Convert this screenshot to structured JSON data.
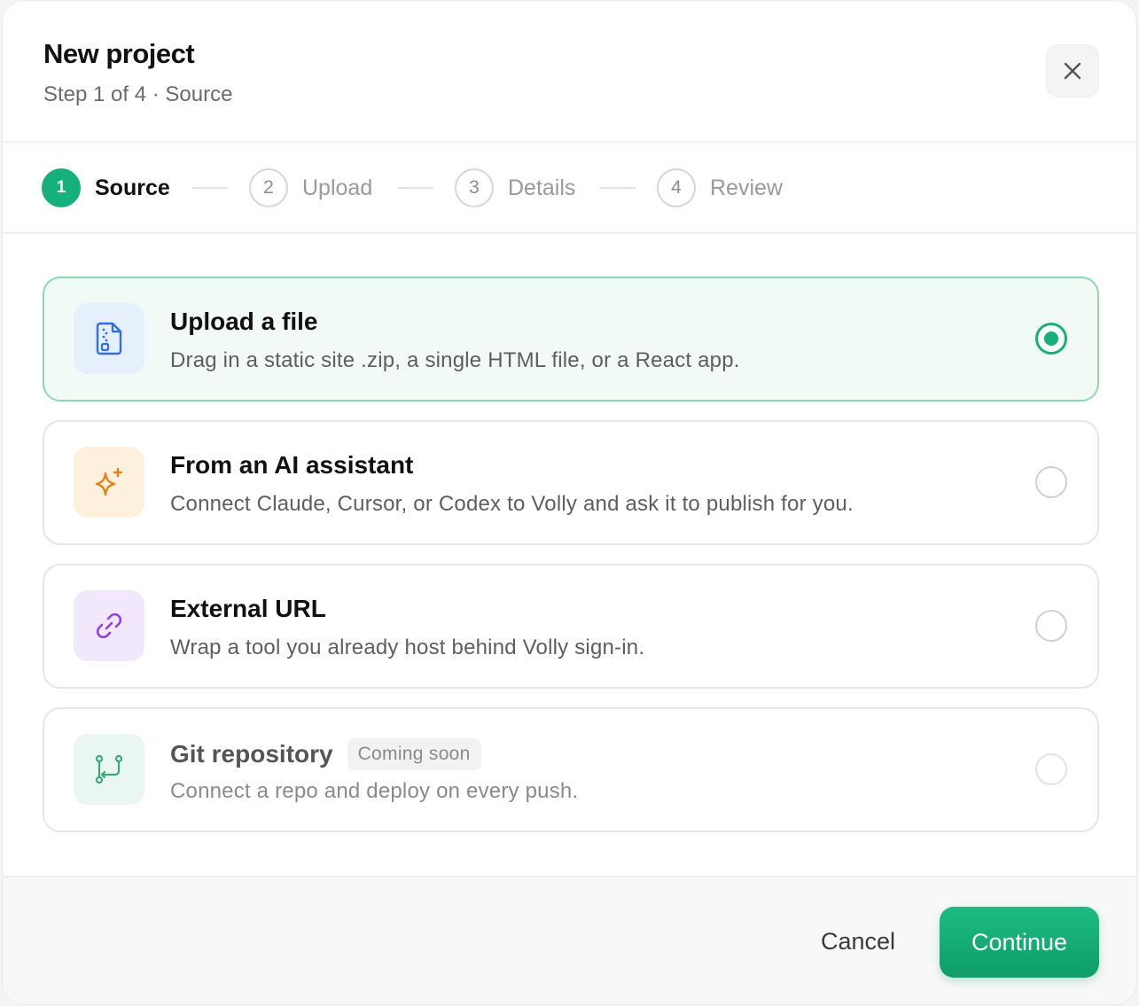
{
  "header": {
    "title": "New project",
    "subtitle": "Step 1 of 4 · Source"
  },
  "stepper": {
    "steps": [
      {
        "number": "1",
        "label": "Source",
        "active": true
      },
      {
        "number": "2",
        "label": "Upload",
        "active": false
      },
      {
        "number": "3",
        "label": "Details",
        "active": false
      },
      {
        "number": "4",
        "label": "Review",
        "active": false
      }
    ]
  },
  "options": [
    {
      "title": "Upload a file",
      "description": "Drag in a static site .zip, a single HTML file, or a React app.",
      "icon": "file-upload-icon",
      "selected": true
    },
    {
      "title": "From an AI assistant",
      "description": "Connect Claude, Cursor, or Codex to Volly and ask it to publish for you.",
      "icon": "sparkle-icon",
      "selected": false
    },
    {
      "title": "External URL",
      "description": "Wrap a tool you already host behind Volly sign-in.",
      "icon": "link-icon",
      "selected": false
    },
    {
      "title": "Git repository",
      "badge": "Coming soon",
      "description": "Connect a repo and deploy on every push.",
      "icon": "git-branch-icon",
      "selected": false,
      "disabled": true
    }
  ],
  "footer": {
    "cancel_label": "Cancel",
    "continue_label": "Continue"
  },
  "colors": {
    "accent": "#16b07a",
    "selected_border": "#8ed6b4",
    "upload_icon_bg": "#e6effc",
    "ai_icon_bg": "#fdf0dd",
    "url_icon_bg": "#f1e8fd",
    "git_icon_bg": "#e9f7f0"
  }
}
